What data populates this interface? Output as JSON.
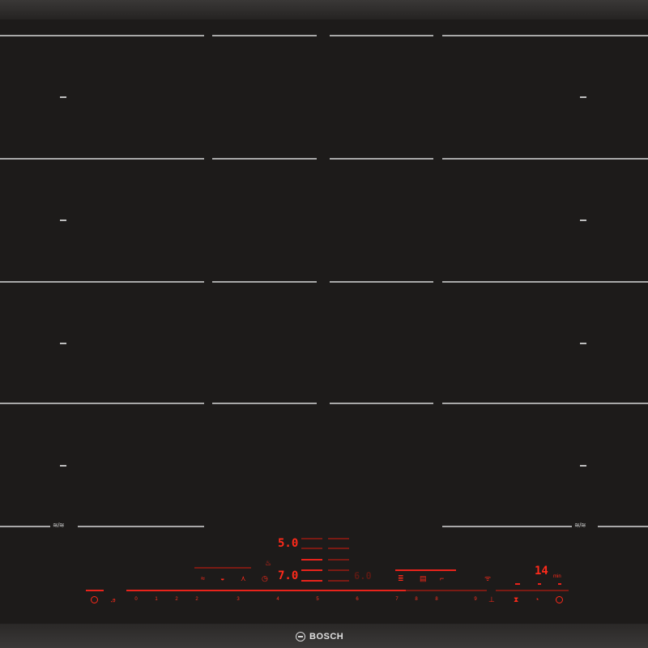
{
  "brand": {
    "name": "BOSCH"
  },
  "zones": {
    "flex_label_left": "≋/≋",
    "flex_label_right": "≋/≋",
    "idle_indicator": "–"
  },
  "controls": {
    "power_level_upper": "5.0",
    "power_level_main": "7.0",
    "power_level_secondary": "6.0",
    "timer_value": "14",
    "timer_unit": "min",
    "slider_scale": [
      "0",
      "1",
      "2",
      "3",
      "4",
      "5",
      "6",
      "7",
      "8",
      "9"
    ],
    "slider_scale_right": [
      "1",
      "2",
      "3",
      "4",
      "5",
      "6",
      "7",
      "8",
      "9"
    ]
  },
  "colors": {
    "glass": "#211f1e",
    "zone_line": "#a9a9a9",
    "display_red": "#ff2a1a"
  },
  "icons": [
    "power-icon",
    "childlock-icon",
    "sensor-icon",
    "frying-icon",
    "boost-icon",
    "timer-icon",
    "move-icon",
    "flex-zone-icon",
    "powermove-icon",
    "wifi-icon",
    "alarm-icon",
    "hourglass-icon",
    "stopwatch-icon"
  ]
}
